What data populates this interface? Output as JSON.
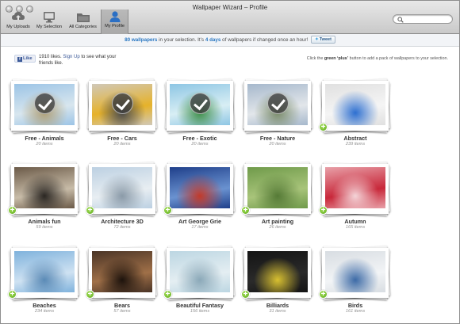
{
  "window": {
    "title": "Wallpaper Wizard – Profile"
  },
  "toolbar": {
    "buttons": [
      {
        "label": "My Uploads",
        "icon": "cloud-upload-icon"
      },
      {
        "label": "My Selection",
        "icon": "monitor-icon"
      },
      {
        "label": "All Categories",
        "icon": "folder-icon"
      },
      {
        "label": "My Profile",
        "icon": "user-icon",
        "active": true
      }
    ],
    "search": {
      "placeholder": ""
    }
  },
  "infobar": {
    "count": "80 wallpapers",
    "text1": " in your selection. It’s ",
    "interval": "4 days",
    "text2": " of wallpapers if changed once an hour!",
    "tweet_label": "Tweet"
  },
  "social": {
    "like_label": "Like",
    "likes_text": "1910 likes. ",
    "signup_label": "Sign Up",
    "after_signup": " to see what your friends like."
  },
  "hint": {
    "before": "Click the ",
    "bold": "green ‘plus’",
    "after": " button to add a pack of wallpapers to your selection."
  },
  "categories": [
    {
      "name": "Free - Animals",
      "count": "20 items",
      "selected": true,
      "palette": [
        "#9cc4e6",
        "#d8e6ee",
        "#b0a078"
      ]
    },
    {
      "name": "Free - Cars",
      "count": "20 items",
      "selected": true,
      "palette": [
        "#d0c8b8",
        "#e6b22a",
        "#4a4a4a"
      ]
    },
    {
      "name": "Free - Exotic",
      "count": "20 items",
      "selected": true,
      "palette": [
        "#8ec6e4",
        "#d8eef4",
        "#3f8f4a"
      ]
    },
    {
      "name": "Free - Nature",
      "count": "20 items",
      "selected": true,
      "palette": [
        "#a6b8cc",
        "#e2e6ea",
        "#7a8c6a"
      ]
    },
    {
      "name": "Abstract",
      "count": "239 items",
      "selected": false,
      "palette": [
        "#e0e0e0",
        "#f5f5f5",
        "#2d6fd0"
      ]
    },
    {
      "name": "Animals fun",
      "count": "59 items",
      "selected": false,
      "palette": [
        "#6b5a48",
        "#c8bca8",
        "#2a2622"
      ]
    },
    {
      "name": "Architecture 3D",
      "count": "72 items",
      "selected": false,
      "palette": [
        "#bcd0e2",
        "#e8eef2",
        "#8a9aa8"
      ]
    },
    {
      "name": "Art George Grie",
      "count": "17 items",
      "selected": false,
      "palette": [
        "#1f3f8a",
        "#6a92d0",
        "#c23a2a"
      ]
    },
    {
      "name": "Art painting",
      "count": "26 items",
      "selected": false,
      "palette": [
        "#6f9a4a",
        "#a8c47a",
        "#557a36"
      ]
    },
    {
      "name": "Autumn",
      "count": "165 items",
      "selected": false,
      "palette": [
        "#e8a0a8",
        "#c8283a",
        "#f4d4d8"
      ]
    },
    {
      "name": "Beaches",
      "count": "234 items",
      "selected": false,
      "palette": [
        "#7fb2dc",
        "#cfe2f2",
        "#5a8ab6"
      ]
    },
    {
      "name": "Bears",
      "count": "57 items",
      "selected": false,
      "palette": [
        "#4a3426",
        "#a07048",
        "#1c120c"
      ]
    },
    {
      "name": "Beautiful Fantasy",
      "count": "156 items",
      "selected": false,
      "palette": [
        "#bcd6e2",
        "#e4eef2",
        "#8aa8b8"
      ]
    },
    {
      "name": "Billiards",
      "count": "31 items",
      "selected": false,
      "palette": [
        "#141414",
        "#2a2a2a",
        "#d8c030"
      ]
    },
    {
      "name": "Birds",
      "count": "161 items",
      "selected": false,
      "palette": [
        "#d8dde2",
        "#f2f4f6",
        "#3c6aa6"
      ]
    }
  ]
}
